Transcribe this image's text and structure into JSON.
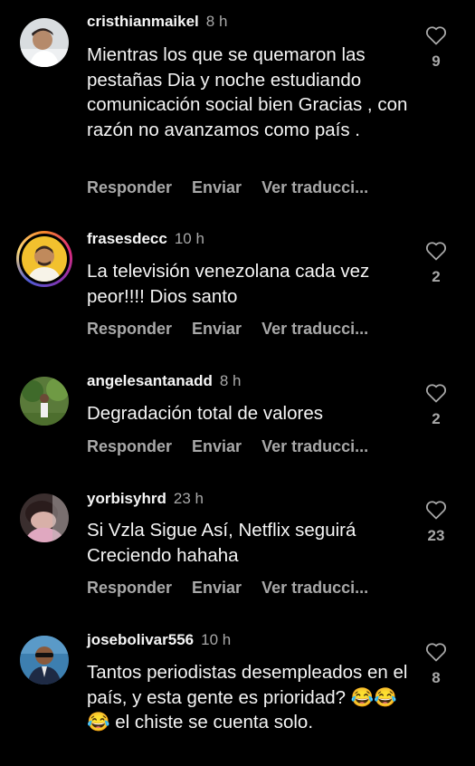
{
  "comments": [
    {
      "username": "cristhianmaikel",
      "time": "8 h",
      "text": "Mientras los que se quemaron las pestañas Dia y noche estudiando comunicación social bien Gracias , con razón no avanzamos como país .",
      "likes": "9",
      "has_story": false,
      "avatar_icon": "avatar-person-white-shirt"
    },
    {
      "username": "frasesdecc",
      "time": "10 h",
      "text": "La televisión venezolana cada vez peor!!!! Dios santo",
      "likes": "2",
      "has_story": true,
      "avatar_icon": "avatar-person-yellow-bg"
    },
    {
      "username": "angelesantanadd",
      "time": "8 h",
      "text": "Degradación total de valores",
      "likes": "2",
      "has_story": false,
      "avatar_icon": "avatar-person-garden"
    },
    {
      "username": "yorbisyhrd",
      "time": "23 h",
      "text": "Si Vzla Sigue Así, Netflix seguirá Creciendo hahaha",
      "likes": "23",
      "has_story": false,
      "avatar_icon": "avatar-person-pink"
    },
    {
      "username": "josebolivar556",
      "time": "10 h",
      "text": "Tantos periodistas desempleados en el país, y esta gente es prioridad? 😂😂😂 el chiste se cuenta solo.",
      "likes": "8",
      "has_story": false,
      "avatar_icon": "avatar-person-sunglasses"
    }
  ],
  "actions": {
    "reply": "Responder",
    "send": "Enviar",
    "translate": "Ver traducci..."
  },
  "colors": {
    "background": "#000000",
    "primary_text": "#f5f5f5",
    "secondary_text": "#a8a8a8"
  }
}
